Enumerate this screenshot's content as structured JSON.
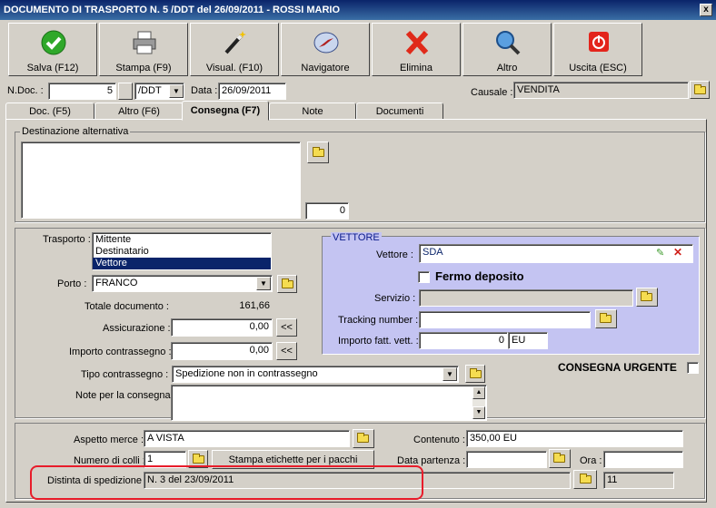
{
  "window": {
    "title": "DOCUMENTO DI TRASPORTO N. 5 /DDT del 26/09/2011 - ROSSI MARIO",
    "close": "x"
  },
  "toolbar": {
    "save": "Salva (F12)",
    "print": "Stampa (F9)",
    "view": "Visual. (F10)",
    "navigator": "Navigatore",
    "delete": "Elimina",
    "other": "Altro",
    "exit": "Uscita (ESC)"
  },
  "header": {
    "ndoc_label": "N.Doc. :",
    "ndoc_value": "5",
    "series": "/DDT",
    "data_label": "Data :",
    "data_value": "26/09/2011",
    "causale_label": "Causale :",
    "causale_value": "VENDITA"
  },
  "tabs": [
    "Doc. (F5)",
    "Altro (F6)",
    "Consegna (F7)",
    "Note",
    "Documenti"
  ],
  "dest": {
    "legend": "Destinazione alternativa",
    "count": "0"
  },
  "trasporto": {
    "label": "Trasporto :",
    "options": [
      "Mittente",
      "Destinatario",
      "Vettore"
    ],
    "selected": 2
  },
  "porto": {
    "label": "Porto :",
    "value": "FRANCO"
  },
  "totale": {
    "label": "Totale documento :",
    "value": "161,66"
  },
  "assicurazione": {
    "label": "Assicurazione :",
    "value": "0,00",
    "btn": "<<"
  },
  "contrassegno": {
    "label": "Importo contrassegno :",
    "value": "0,00",
    "btn": "<<"
  },
  "tipo_contr": {
    "label": "Tipo contrassegno :",
    "value": "Spedizione non in contrassegno"
  },
  "note_consegna": {
    "label": "Note per la consegna"
  },
  "vettore": {
    "legend": "VETTORE",
    "vettore_label": "Vettore :",
    "vettore_value": "SDA",
    "fermo_label": "Fermo deposito",
    "servizio_label": "Servizio :",
    "tracking_label": "Tracking number :",
    "importo_label": "Importo fatt. vett. :",
    "importo_value": "0",
    "valuta": "EU"
  },
  "urgente": {
    "label": "CONSEGNA URGENTE"
  },
  "bottom": {
    "aspetto_label": "Aspetto merce :",
    "aspetto_value": "A VISTA",
    "contenuto_label": "Contenuto :",
    "contenuto_value": "350,00 EU",
    "colli_label": "Numero di colli :",
    "colli_value": "1",
    "stampa_btn": "Stampa etichette per i pacchi",
    "partenza_label": "Data partenza :",
    "ora_label": "Ora :",
    "distinta_label": "Distinta di spedizione :",
    "distinta_value": "N. 3 del 23/09/2011",
    "distinta_num": "11"
  },
  "colors": {
    "highlight": "#e81c2a",
    "vettore_bg": "#c4c4f2",
    "selected": "#0a246a"
  }
}
